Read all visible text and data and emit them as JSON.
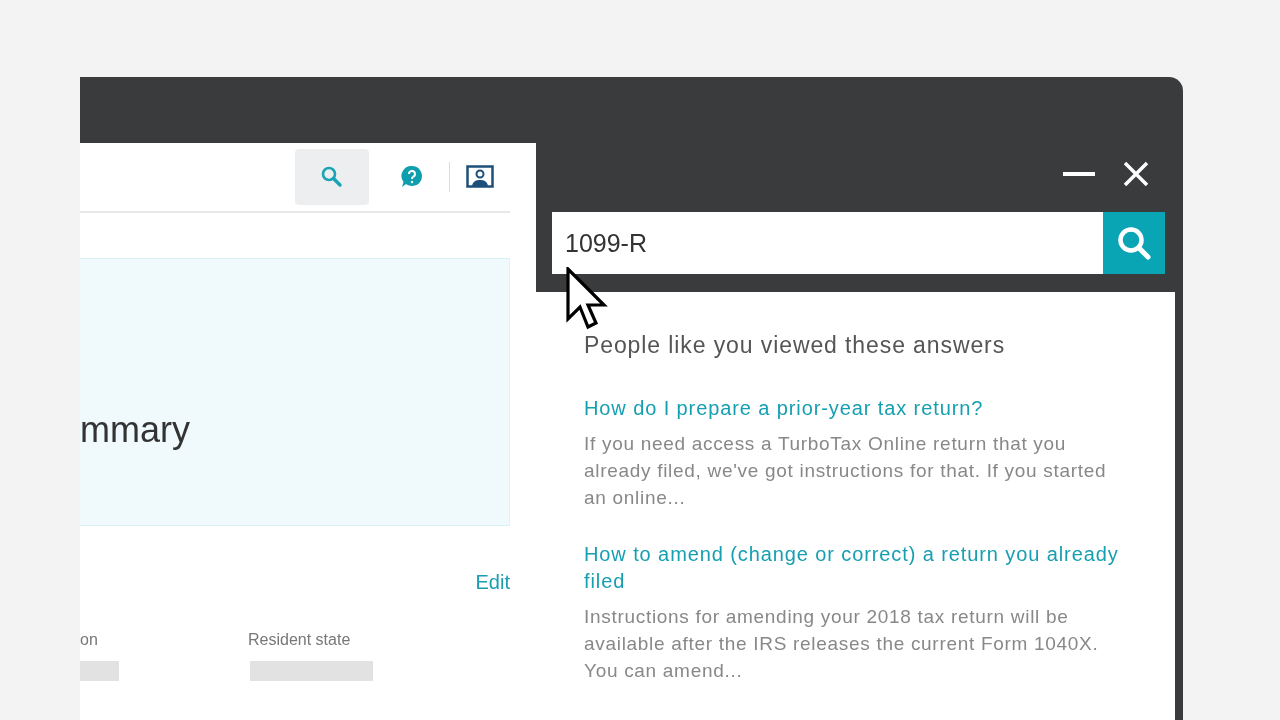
{
  "app": {
    "toolbar": [
      {
        "kind": "search",
        "selected": true
      },
      {
        "kind": "help",
        "selected": false
      },
      {
        "kind": "profile",
        "selected": false
      }
    ],
    "summary": {
      "title": "mmary"
    },
    "section": {
      "edit": "Edit",
      "fields": [
        {
          "label": "on"
        },
        {
          "label": "Resident state"
        }
      ]
    }
  },
  "search_panel": {
    "query": "1099-R",
    "heading": "People like you viewed these answers",
    "answers": [
      {
        "title": "How do I prepare a prior-year tax return?",
        "snippet": "If you need access a TurboTax Online return that you already filed, we've got instructions for that. If you started an online..."
      },
      {
        "title": "How to amend (change or correct) a return you already filed",
        "snippet": "Instructions for amending your 2018 tax return will be available after the IRS releases the current Form 1040X. You can amend..."
      }
    ]
  }
}
